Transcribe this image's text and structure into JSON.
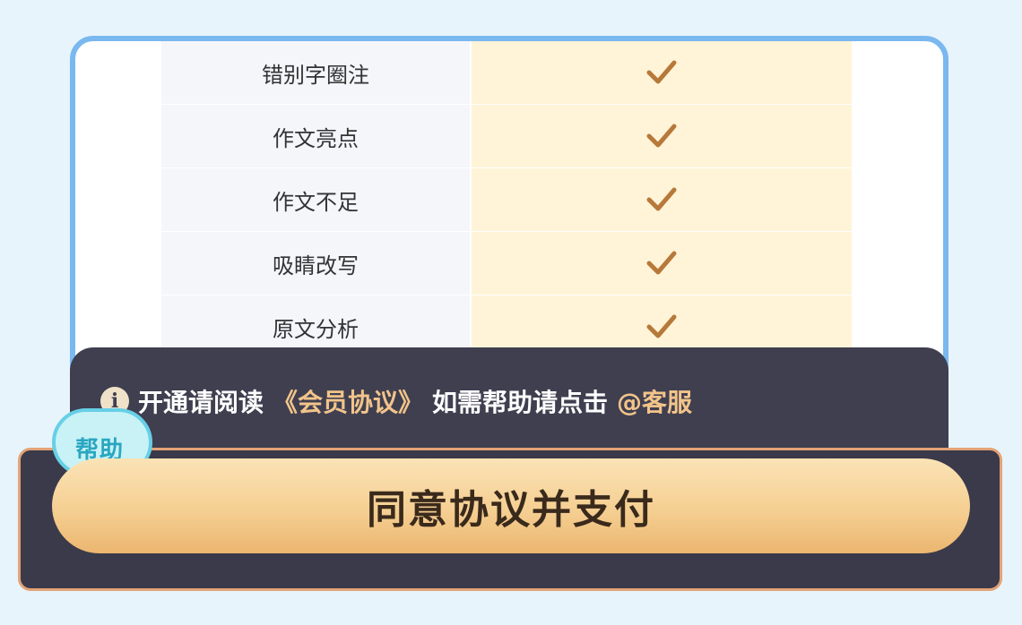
{
  "features": [
    {
      "label": "错别字圈注",
      "included": true
    },
    {
      "label": "作文亮点",
      "included": true
    },
    {
      "label": "作文不足",
      "included": true
    },
    {
      "label": "吸睛改写",
      "included": true
    },
    {
      "label": "原文分析",
      "included": true
    }
  ],
  "notice": {
    "icon": "info-icon",
    "prefix": "开通请阅读",
    "agreement_link": "《会员协议》",
    "middle": "如需帮助请点击",
    "service_link": "@客服"
  },
  "help_bubble": {
    "label": "帮助"
  },
  "pay_button": {
    "label": "同意协议并支付"
  },
  "colors": {
    "accent": "#f2c48a",
    "check": "#b7793a",
    "button_gradient_top": "#fbe3b6",
    "button_gradient_bottom": "#ebb66f",
    "panel": "#3f3f50",
    "card_border": "#7ab8f0"
  }
}
